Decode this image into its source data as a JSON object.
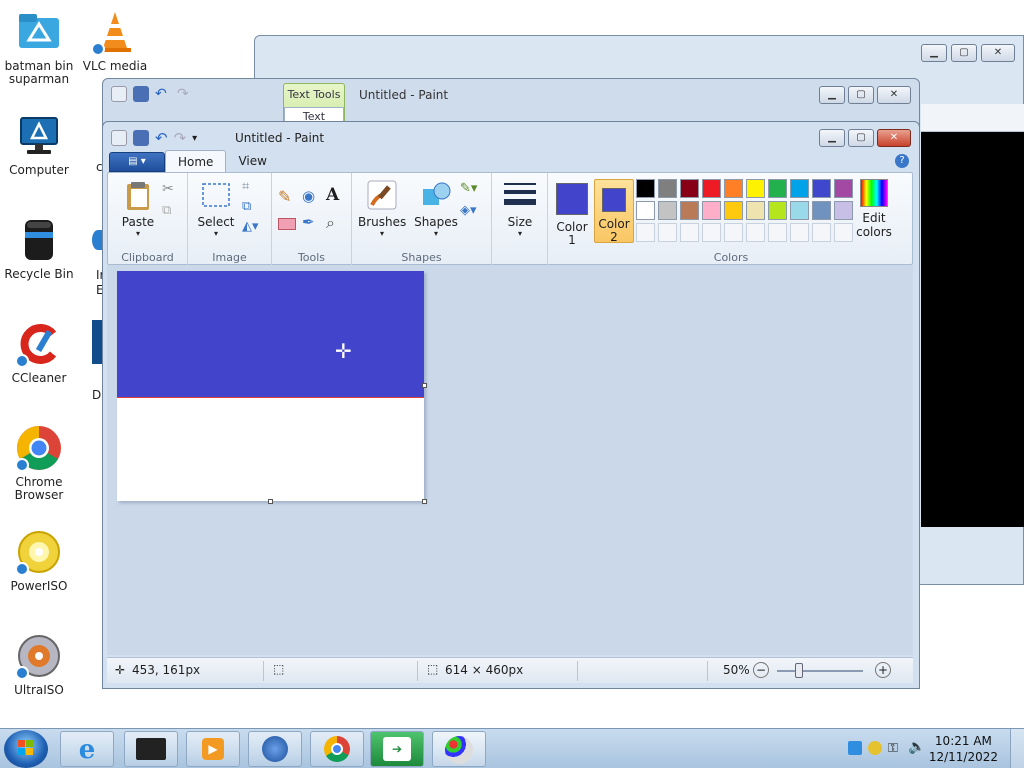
{
  "desktop": {
    "icons": [
      {
        "label": "batman bin suparman",
        "icon": "folder-icon"
      },
      {
        "label": "VLC media",
        "icon": "vlc-icon"
      },
      {
        "label": "Computer",
        "icon": "computer-icon"
      },
      {
        "label": "Recycle Bin",
        "icon": "recycle-bin-icon"
      },
      {
        "label": "CCleaner",
        "icon": "ccleaner-icon"
      },
      {
        "label": "Chrome Browser",
        "icon": "chrome-icon"
      },
      {
        "label": "PowerISO",
        "icon": "poweriso-icon"
      },
      {
        "label": "UltraISO",
        "icon": "ultraiso-icon"
      }
    ],
    "partial_labels": [
      "c",
      "Ir",
      "E",
      "D"
    ]
  },
  "back_paint_window": {
    "title": "Untitled - Paint",
    "contextual_tab": "Text Tools",
    "contextual_sub": "Text",
    "tabs": [
      "Home",
      "View"
    ]
  },
  "paint": {
    "title": "Untitled - Paint",
    "tabs": [
      "Home",
      "View"
    ],
    "active_tab": "Home",
    "groups": {
      "clipboard": {
        "label": "Clipboard",
        "paste": "Paste"
      },
      "image": {
        "label": "Image",
        "select": "Select"
      },
      "tools": {
        "label": "Tools"
      },
      "shapes": {
        "label": "Shapes",
        "brushes": "Brushes",
        "shapes_btn": "Shapes"
      },
      "size": {
        "label": "Size"
      },
      "colors": {
        "label": "Colors",
        "color1": {
          "label": "Color 1",
          "value": "#4244cc"
        },
        "color2": {
          "label": "Color 2",
          "value": "#4244cc"
        },
        "edit": "Edit colors",
        "palette_row1": [
          "#000000",
          "#7f7f7f",
          "#880015",
          "#ed1c24",
          "#ff7f27",
          "#fff200",
          "#22b14c",
          "#00a2e8",
          "#3f48cc",
          "#a349a4"
        ],
        "palette_row2": [
          "#ffffff",
          "#c3c3c3",
          "#b97a57",
          "#ffaec9",
          "#ffc90e",
          "#efe4b0",
          "#b5e61d",
          "#99d9ea",
          "#7092be",
          "#c8bfe7"
        ],
        "palette_row3": [
          "#f4f6f9",
          "#f4f6f9",
          "#f4f6f9",
          "#f4f6f9",
          "#f4f6f9",
          "#f4f6f9",
          "#f4f6f9",
          "#f4f6f9",
          "#f4f6f9",
          "#f4f6f9"
        ]
      }
    },
    "canvas": {
      "fill_color": "#4244cc",
      "fill_fraction": 0.55
    },
    "status": {
      "cursor_pos": "453, 161px",
      "image_size": "614 × 460px",
      "zoom": "50%"
    }
  },
  "taskbar": {
    "time": "10:21 AM",
    "date": "12/11/2022",
    "apps": [
      "internet-explorer-icon",
      "media-center-icon",
      "media-player-icon",
      "app-icon",
      "chrome-icon",
      "remote-app-icon",
      "paint-icon"
    ]
  }
}
